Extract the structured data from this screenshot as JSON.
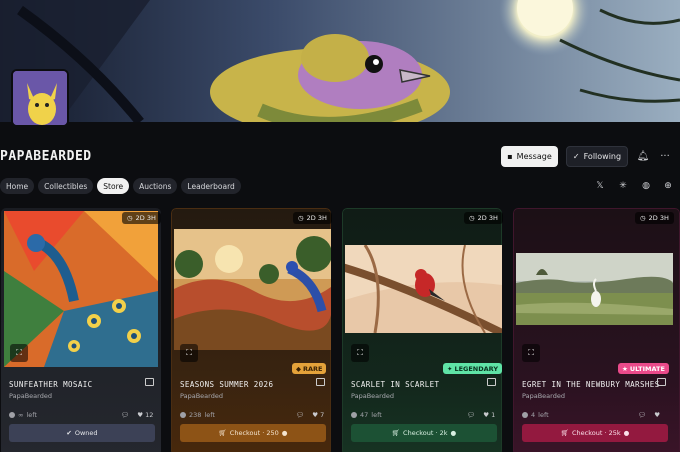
{
  "profile": {
    "name": "PAPABEARDED"
  },
  "actions": {
    "message": "Message",
    "following": "Following"
  },
  "tabs": [
    {
      "label": "Home"
    },
    {
      "label": "Collectibles"
    },
    {
      "label": "Store",
      "active": true
    },
    {
      "label": "Auctions"
    },
    {
      "label": "Leaderboard"
    }
  ],
  "socials": [
    "x-icon",
    "asterisk-icon",
    "globe-icon",
    "web-icon"
  ],
  "cards": [
    {
      "timer": "2D 3H",
      "title": "SUNFEATHER MOSAIC",
      "creator": "PapaBearded",
      "stock": "∞",
      "stock_suffix": "left",
      "likes": "12",
      "button": "Owned",
      "badge": ""
    },
    {
      "timer": "2D 3H",
      "title": "SEASONS SUMMER 2026",
      "creator": "PapaBearded",
      "stock": "238",
      "stock_suffix": "left",
      "likes": "7",
      "button": "Checkout · 250",
      "badge": "RARE"
    },
    {
      "timer": "2D 3H",
      "title": "SCARLET IN SCARLET",
      "creator": "PapaBearded",
      "stock": "47",
      "stock_suffix": "left",
      "likes": "1",
      "button": "Checkout · 2k",
      "badge": "LEGENDARY"
    },
    {
      "timer": "2D 3H",
      "title": "EGRET IN THE NEWBURY MARSHES",
      "creator": "PapaBearded",
      "stock": "4",
      "stock_suffix": "left",
      "likes": "",
      "button": "Checkout · 25k",
      "badge": "ULTIMATE"
    }
  ],
  "colors": {
    "rare": "#e4a23a",
    "legendary": "#5fe3a6",
    "ultimate": "#ea4a8a",
    "owned_btn": "#3c4156",
    "rare_btn": "#8d5316",
    "legendary_btn": "#1c5134",
    "ultimate_btn": "#93193f"
  }
}
